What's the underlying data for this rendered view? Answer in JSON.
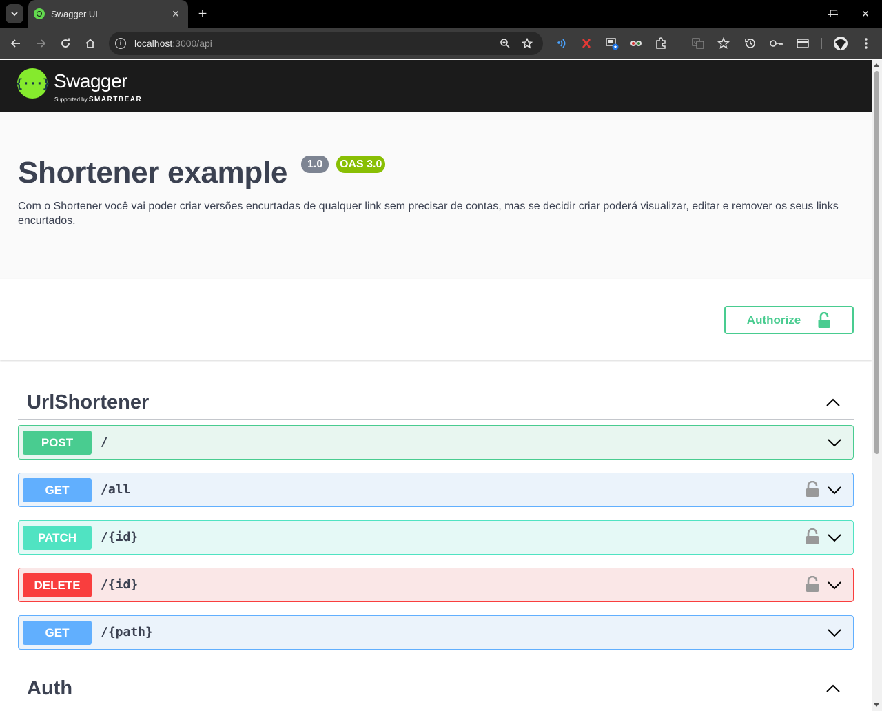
{
  "browser": {
    "tab_title": "Swagger UI",
    "tab_close": "✕",
    "new_tab": "+",
    "url_host": "localhost",
    "url_rest": ":3000/api",
    "window_controls": {
      "minimize": "—",
      "maximize": "☐",
      "close": "✕"
    }
  },
  "swagger": {
    "brand": "Swagger",
    "tagline_prefix": "Supported by",
    "tagline_brand": "SMARTBEAR"
  },
  "info": {
    "title": "Shortener example",
    "version": "1.0",
    "oas": "OAS 3.0",
    "description": "Com o Shortener você vai poder criar versões encurtadas de qualquer link sem precisar de contas, mas se decidir criar poderá visualizar, editar e remover os seus links encurtados."
  },
  "authorize_label": "Authorize",
  "tags": [
    {
      "name": "UrlShortener",
      "operations": [
        {
          "method": "POST",
          "path": "/",
          "locked": false
        },
        {
          "method": "GET",
          "path": "/all",
          "locked": true
        },
        {
          "method": "PATCH",
          "path": "/{id}",
          "locked": true
        },
        {
          "method": "DELETE",
          "path": "/{id}",
          "locked": true
        },
        {
          "method": "GET",
          "path": "/{path}",
          "locked": false
        }
      ]
    },
    {
      "name": "Auth",
      "operations": []
    }
  ],
  "colors": {
    "post": "#49cc90",
    "get": "#61affe",
    "patch": "#50e3c2",
    "delete": "#f93e3e",
    "swagger_green": "#85ea2d",
    "oas_badge": "#89bf04"
  }
}
